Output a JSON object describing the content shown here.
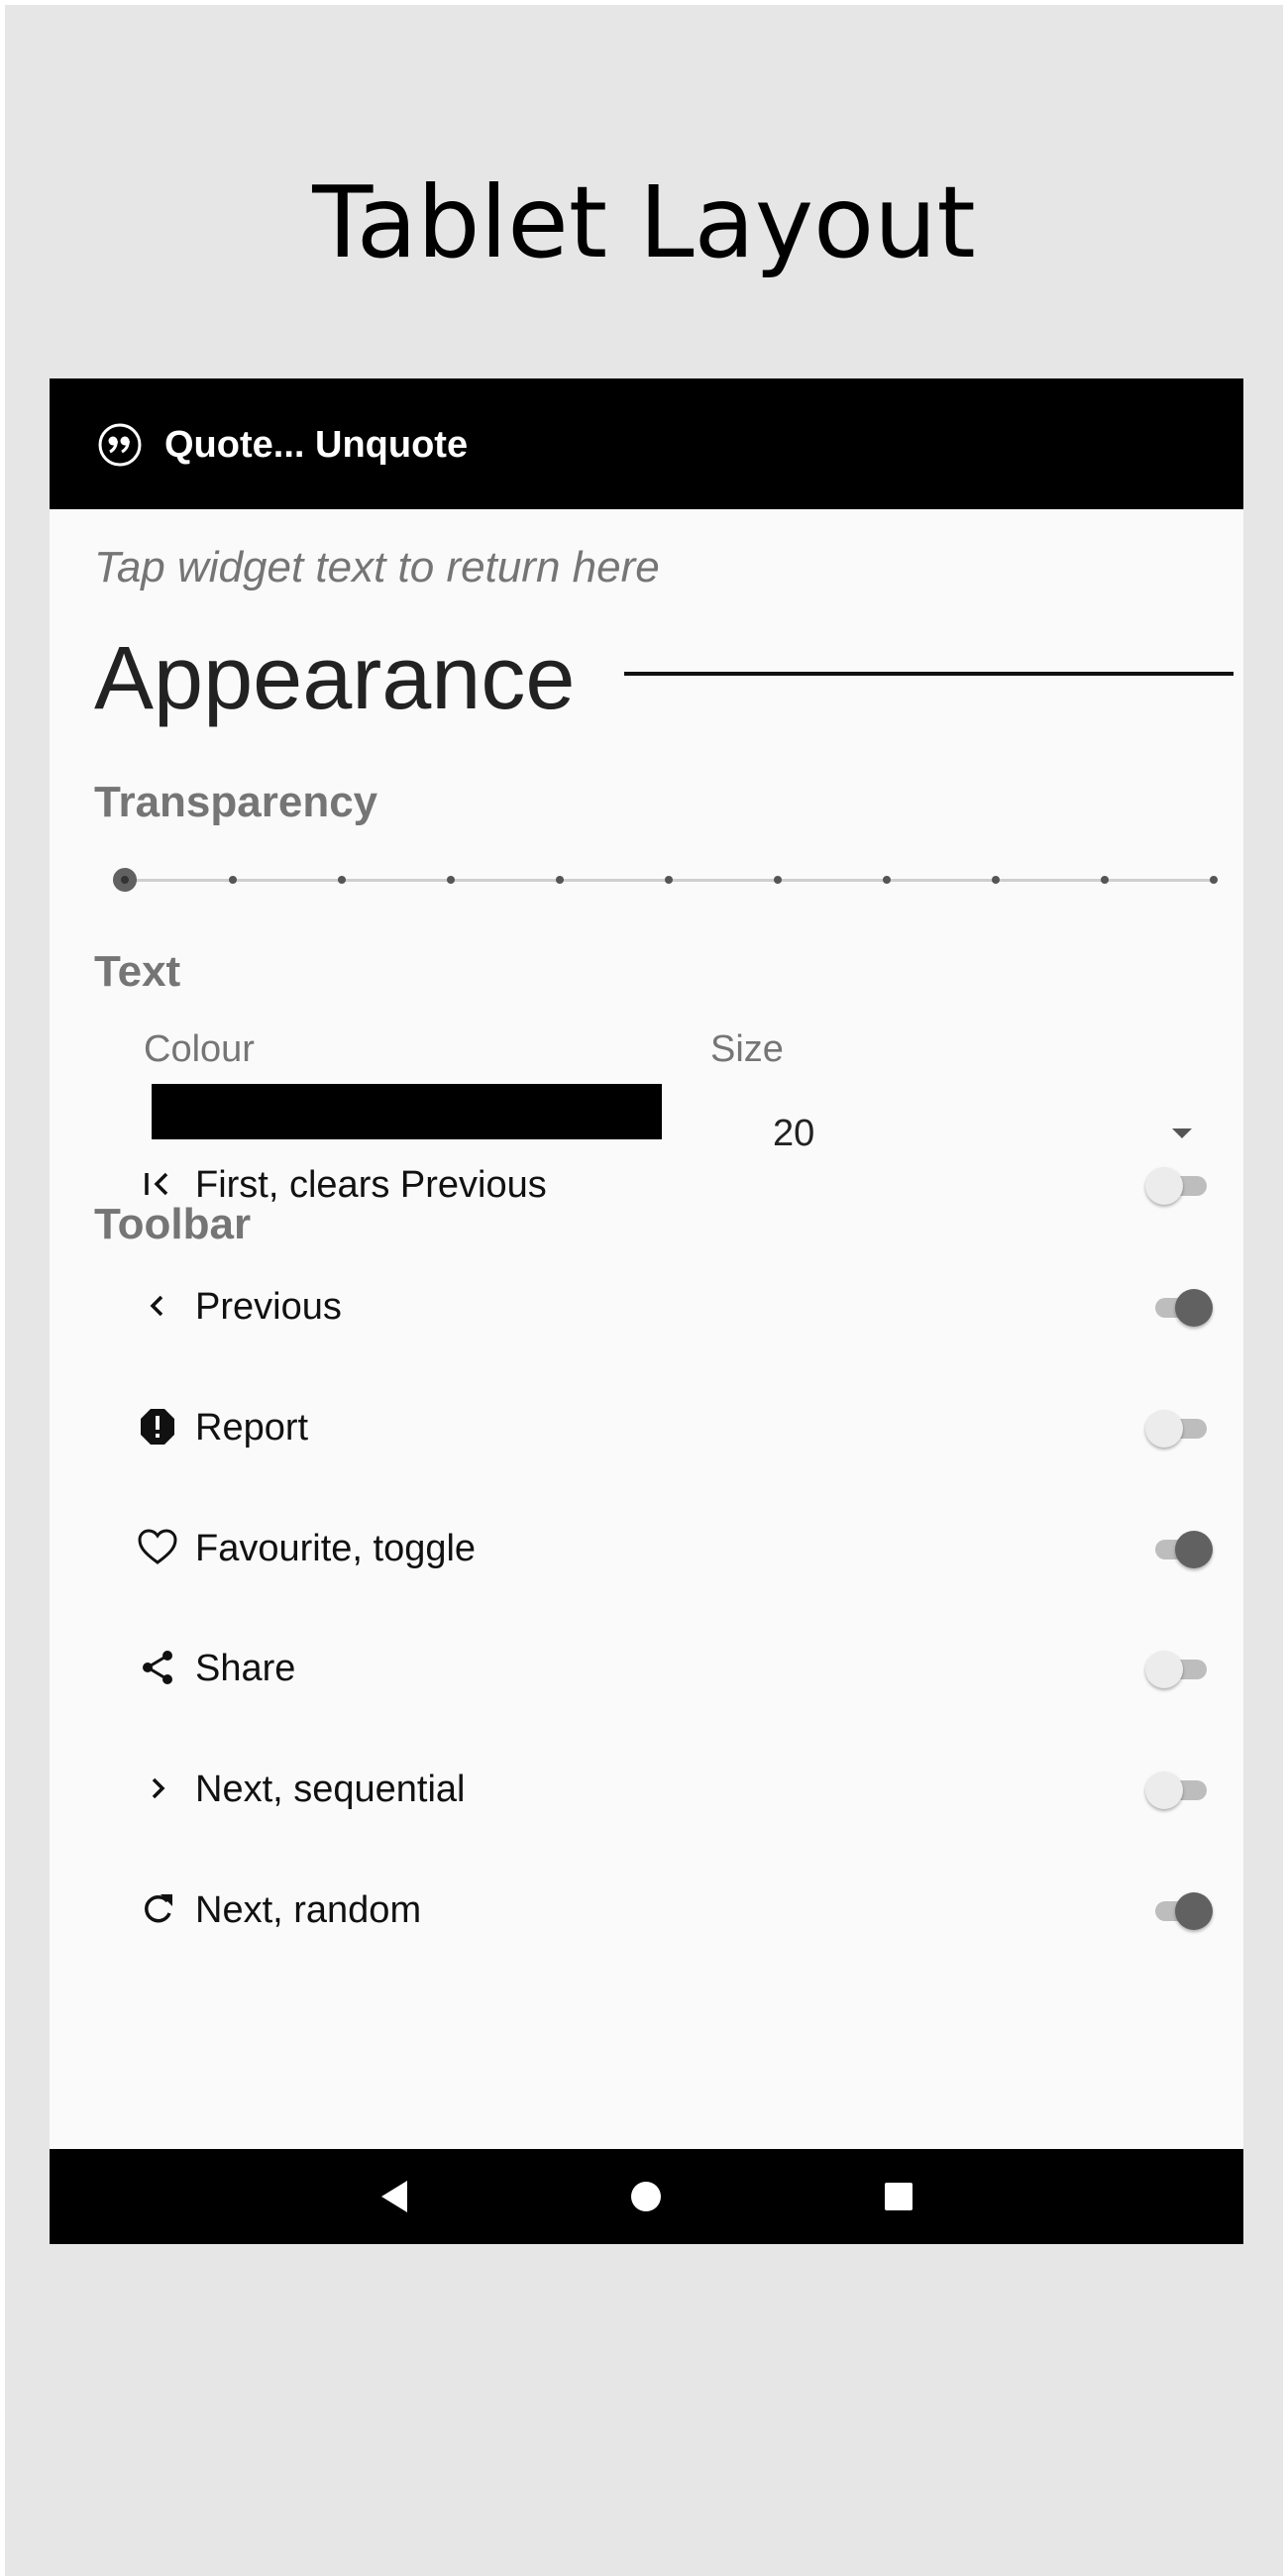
{
  "page_title": "Tablet Layout",
  "app": {
    "title": "Quote... Unquote",
    "icon": "quote-icon"
  },
  "hint": "Tap widget text to return here",
  "section_title": "Appearance",
  "transparency": {
    "label": "Transparency",
    "level": 0,
    "steps": 11
  },
  "text": {
    "label": "Text",
    "colour_label": "Colour",
    "colour_value": "#000000",
    "size_label": "Size",
    "size_value": "20"
  },
  "toolbar": {
    "label": "Toolbar",
    "items": [
      {
        "icon": "first-page-icon",
        "label": "First, clears Previous",
        "enabled": false
      },
      {
        "icon": "chevron-left-icon",
        "label": "Previous",
        "enabled": true
      },
      {
        "icon": "report-icon",
        "label": "Report",
        "enabled": false
      },
      {
        "icon": "heart-icon",
        "label": "Favourite, toggle",
        "enabled": true
      },
      {
        "icon": "share-icon",
        "label": "Share",
        "enabled": false
      },
      {
        "icon": "chevron-right-icon",
        "label": "Next, sequential",
        "enabled": false
      },
      {
        "icon": "refresh-icon",
        "label": "Next, random",
        "enabled": true
      }
    ]
  },
  "nav": {
    "back_icon": "back-icon",
    "home_icon": "home-icon",
    "recents_icon": "recents-icon"
  }
}
